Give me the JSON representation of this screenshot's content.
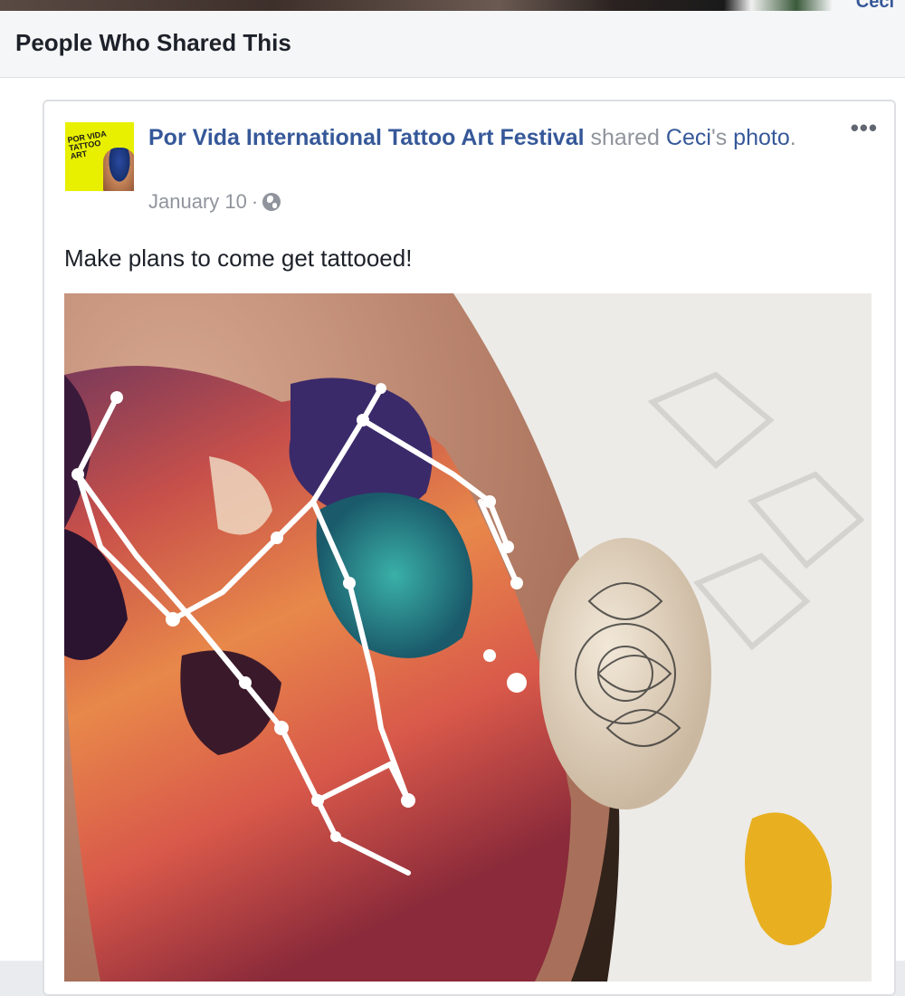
{
  "top_strip": {
    "peek_text": "Ceci"
  },
  "dialog": {
    "title": "People Who Shared This"
  },
  "post": {
    "page_name": "Por Vida International Tattoo Art Festival",
    "shared_word": "shared",
    "owner_name": "Ceci",
    "owner_suffix": "'s",
    "object_link": "photo",
    "period": ".",
    "date": "January 10",
    "separator": "·",
    "privacy_icon": "globe-icon",
    "more_label": "•••",
    "body_text": "Make plans to come get tattooed!",
    "avatar": {
      "logo_line1": "POR VIDA",
      "logo_line2": "TATTOO ART"
    }
  },
  "colors": {
    "link": "#365899",
    "meta": "#90949c",
    "text": "#1d2129",
    "header_bg": "#f5f6f7",
    "avatar_bg": "#e8f000"
  }
}
